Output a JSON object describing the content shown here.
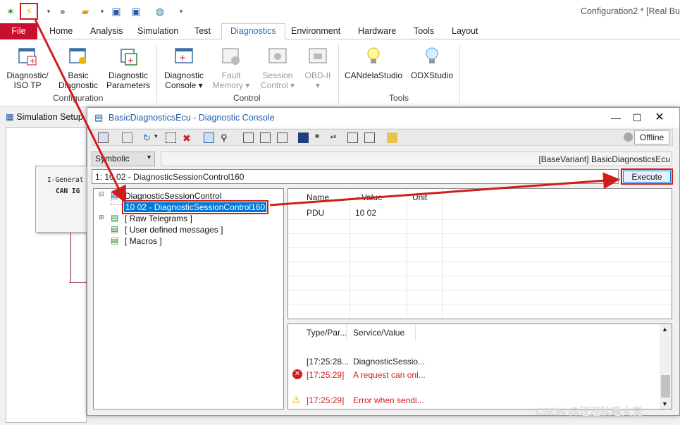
{
  "window_title": "Configuration2 * [Real Bu",
  "ribbon_tabs": [
    "File",
    "Home",
    "Analysis",
    "Simulation",
    "Test",
    "Diagnostics",
    "Environment",
    "Hardware",
    "Tools",
    "Layout"
  ],
  "ribbon": {
    "buttons": [
      {
        "label1": "Diagnostic/",
        "label2": "ISO TP"
      },
      {
        "label1": "Basic",
        "label2": "Diagnostic"
      },
      {
        "label1": "Diagnostic",
        "label2": "Parameters"
      },
      {
        "label1": "Diagnostic",
        "label2": "Console ▾"
      },
      {
        "label1": "Fault",
        "label2": "Memory ▾"
      },
      {
        "label1": "Session",
        "label2": "Control ▾"
      },
      {
        "label1": "OBD-II",
        "label2": "▾"
      },
      {
        "label1": "CANdelaStudio",
        "label2": ""
      },
      {
        "label1": "ODXStudio",
        "label2": ""
      }
    ],
    "groups": [
      "Configuration",
      "Control",
      "Tools"
    ]
  },
  "sim_setup_title": "Simulation Setup",
  "sim_block": {
    "line1": "I-Generat",
    "line2": "CAN IG"
  },
  "dialog": {
    "title": "BasicDiagnosticsEcu - Diagnostic Console",
    "offline": "Offline",
    "combo": "Symbolic",
    "path": "[BaseVariant] BasicDiagnosticsEcu",
    "command": "1: 10 02 - DiagnosticSessionControl160",
    "execute": "Execute",
    "tree": {
      "root": "DiagnosticSessionControl",
      "selected": "10 02 - DiagnosticSessionControl160",
      "items": [
        "[ Raw Telegrams ]",
        "[ User defined messages ]",
        "[ Macros ]"
      ]
    },
    "grid": {
      "headers": [
        "Name",
        "Value",
        "Unit"
      ],
      "rows": [
        {
          "name": "PDU",
          "value": "10 02",
          "unit": ""
        }
      ]
    },
    "log": {
      "headers": [
        "Type/Par...",
        "Service/Value"
      ],
      "rows": [
        {
          "time": "[17:25:28...",
          "text": "DiagnosticSessio...",
          "level": "info"
        },
        {
          "time": "[17:25:29]",
          "text": "A request can onl...",
          "level": "error"
        },
        {
          "time": "[17:25:29]",
          "text": "Error when sendi...",
          "level": "warning"
        }
      ]
    }
  },
  "watermark": "CSDN @汪汪队睡大觉",
  "colors": {
    "accent": "#1e6fbf",
    "file_tab": "#c8102e",
    "highlight": "#d21b1b",
    "selection": "#0078d7"
  }
}
